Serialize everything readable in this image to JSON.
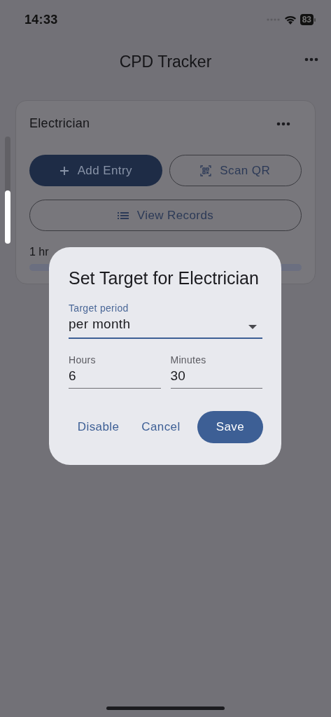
{
  "status_bar": {
    "time": "14:33",
    "battery": "83"
  },
  "app_bar": {
    "title": "CPD Tracker"
  },
  "card": {
    "title": "Electrician",
    "buttons": [
      {
        "label": "Add Entry",
        "kind": "filled"
      },
      {
        "label": "Scan QR",
        "kind": "outlined"
      },
      {
        "label": "View Records",
        "kind": "outlined"
      }
    ],
    "summary": "1 hr"
  },
  "dialog": {
    "title": "Set Target for Electrician",
    "period": {
      "label": "Target period",
      "value": "per month"
    },
    "fields": [
      {
        "label": "Hours",
        "value": "6"
      },
      {
        "label": "Minutes",
        "value": "30"
      }
    ],
    "actions": [
      {
        "label": "Disable",
        "kind": "text"
      },
      {
        "label": "Cancel",
        "kind": "text"
      },
      {
        "label": "Save",
        "kind": "filled"
      }
    ]
  }
}
